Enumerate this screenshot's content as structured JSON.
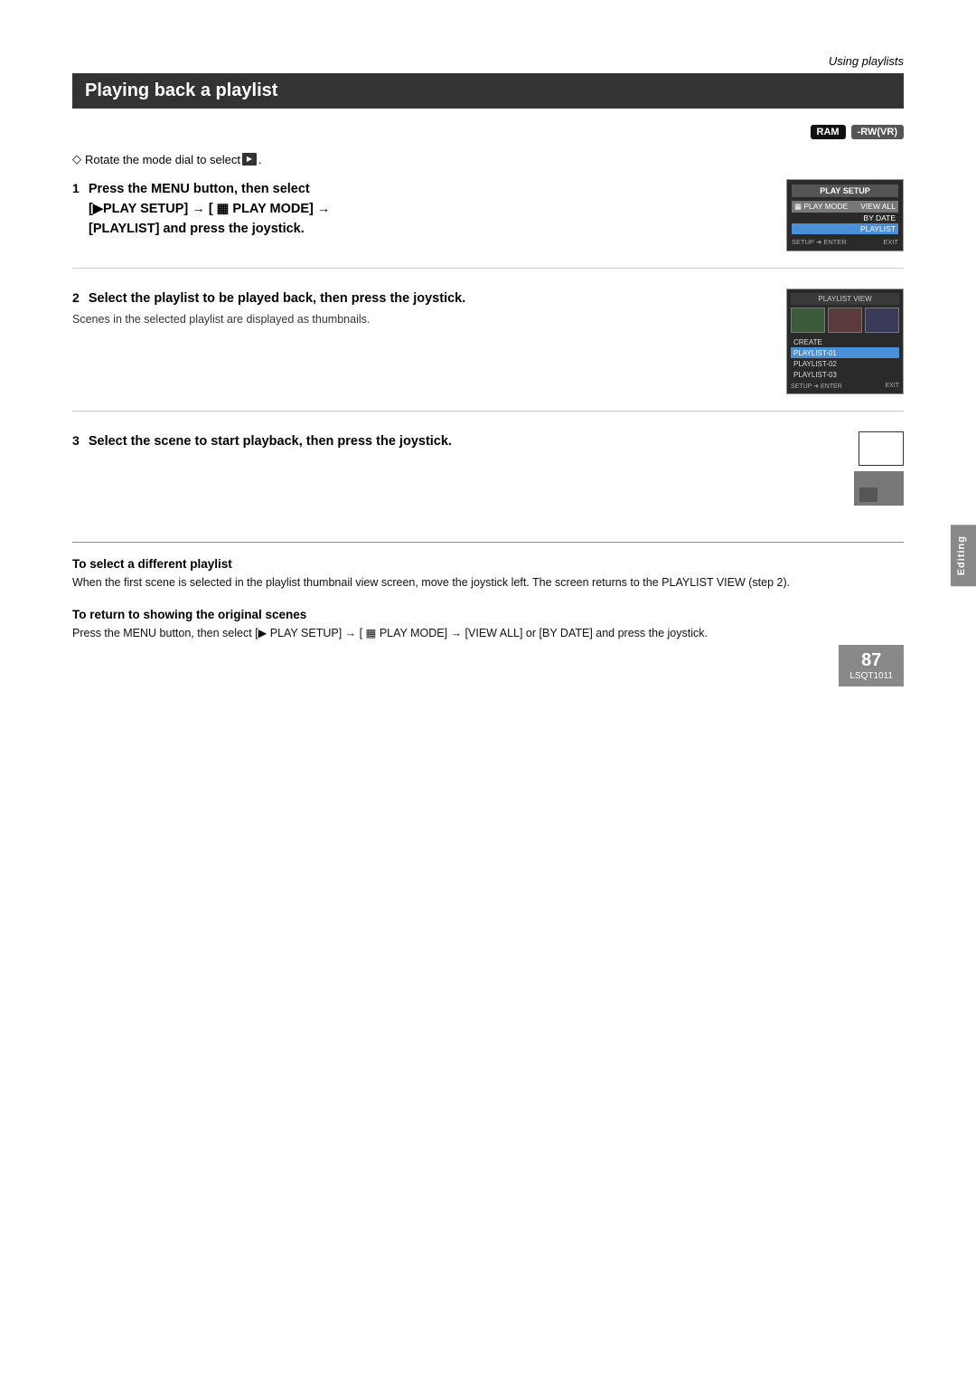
{
  "page": {
    "section_label": "Using playlists",
    "title": "Playing back a playlist",
    "page_number": "87",
    "page_code": "LSQT1011",
    "side_tab": "Editing"
  },
  "badges": {
    "ram": "RAM",
    "rwvr": "-RW(VR)"
  },
  "prereq": {
    "diamond": "◇",
    "text": "Rotate the mode dial to select",
    "icon_label": "▶"
  },
  "steps": [
    {
      "number": "1",
      "title_part1": "Press the MENU button, then select",
      "title_part2": "[▶PLAY SETUP] → [ ▦ PLAY MODE] →",
      "title_part3": "[PLAYLIST] and press the joystick.",
      "screen": {
        "title": "PLAY SETUP",
        "row1_left": "▦ PLAY MODE",
        "row1_right": "VIEW ALL",
        "row2_right": "BY DATE",
        "row3_right": "PLAYLIST",
        "footer_left": "SETUP ➜ ENTER",
        "footer_right": "EXIT"
      }
    },
    {
      "number": "2",
      "title": "Select the playlist to be played back, then press the joystick.",
      "subtitle": "Scenes in the selected playlist are displayed as thumbnails.",
      "screen": {
        "title": "PLAYLIST VIEW",
        "items": [
          "CREATE",
          "PLAYLIST-01",
          "PLAYLIST-02",
          "PLAYLIST-03"
        ],
        "highlighted_index": 1,
        "footer_left": "SETUP ➜ ENTER",
        "footer_right": "EXIT"
      }
    },
    {
      "number": "3",
      "title": "Select the scene to start playback, then press the joystick."
    }
  ],
  "notes": [
    {
      "id": "different_playlist",
      "title": "To select a different playlist",
      "body": "When the first scene is selected in the playlist thumbnail view screen, move the joystick left. The screen returns to the PLAYLIST VIEW (step 2)."
    },
    {
      "id": "return_original",
      "title": "To return to showing the original scenes",
      "body": "Press the MENU button, then select [▶ PLAY SETUP] → [ ▦ PLAY MODE] → [VIEW ALL] or [BY DATE] and press the joystick."
    }
  ]
}
